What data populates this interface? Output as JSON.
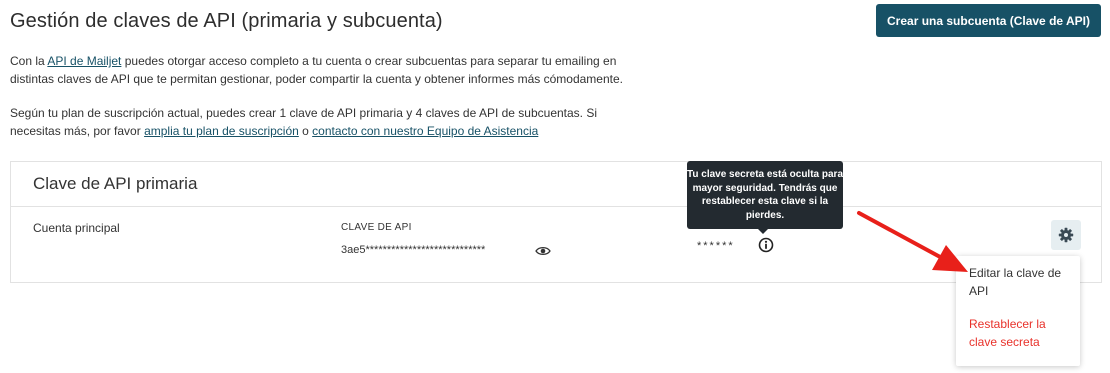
{
  "header": {
    "title": "Gestión de claves de API (primaria y subcuenta)",
    "create_button": "Crear una subcuenta (Clave de API)"
  },
  "intro": {
    "p1_pre": "Con la ",
    "p1_link": "API de Mailjet",
    "p1_post": " puedes otorgar acceso completo a tu cuenta o crear subcuentas para separar tu emailing en distintas claves de API que te permitan gestionar, poder compartir la cuenta y obtener informes más cómodamente.",
    "p2_pre": "Según tu plan de suscripción actual, puedes crear 1 clave de API primaria y 4 claves de API de subcuentas. Si necesitas más, por favor ",
    "p2_link1": "amplia tu plan de suscripción",
    "p2_mid": " o ",
    "p2_link2": "contacto con nuestro Equipo de Asistencia"
  },
  "card": {
    "title": "Clave de API primaria",
    "account_label": "Cuenta principal",
    "key_label": "CLAVE DE API",
    "key_value": "3ae5****************************",
    "secret_mask": "******"
  },
  "tooltip": {
    "text": "Tu clave secreta está oculta para mayor seguridad. Tendrás que restablecer esta clave si la pierdes."
  },
  "menu": {
    "edit": "Editar la clave de API",
    "reset": "Restablecer la clave secreta"
  },
  "colors": {
    "primary": "#175166",
    "danger": "#e8322b",
    "annotation_arrow": "#e8201a"
  }
}
